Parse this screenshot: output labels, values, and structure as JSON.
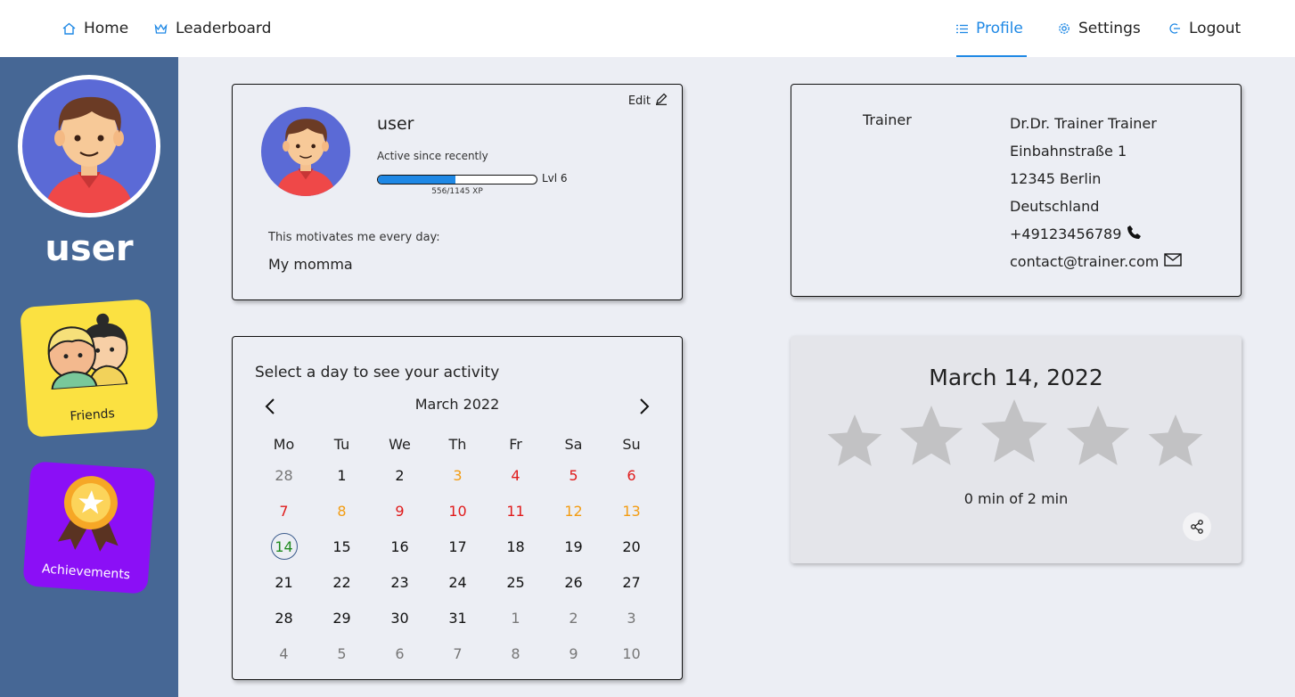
{
  "nav": {
    "home": {
      "label": "Home",
      "icon": "home-icon"
    },
    "leaderboard": {
      "label": "Leaderboard",
      "icon": "crown-icon"
    },
    "profile": {
      "label": "Profile",
      "icon": "list-icon"
    },
    "settings": {
      "label": "Settings",
      "icon": "gear-icon"
    },
    "logout": {
      "label": "Logout",
      "icon": "logout-icon"
    },
    "active_color": "#1e88e5"
  },
  "sidebar": {
    "username": "user",
    "background": "#466795",
    "friends_label": "Friends",
    "achievements_label": "Achievements"
  },
  "profile": {
    "edit_label": "Edit",
    "username": "user",
    "active_since": "Active since recently",
    "level_label": "Lvl 6",
    "xp_text": "556/1145 XP",
    "xp_fraction": 0.486,
    "motto_label": "This motivates me every day:",
    "motto": "My momma"
  },
  "trainer": {
    "role": "Trainer",
    "name": "Dr.Dr. Trainer Trainer",
    "street": "Einbahnstraße 1",
    "city": "12345 Berlin",
    "country": "Deutschland",
    "phone": "+49123456789",
    "email": "contact@trainer.com"
  },
  "calendar": {
    "title": "Select a day to see your activity",
    "month_label": "March 2022",
    "weekdays": [
      "Mo",
      "Tu",
      "We",
      "Th",
      "Fr",
      "Sa",
      "Su"
    ],
    "colors": {
      "gray": "#777777",
      "orange": "#f39c12",
      "red": "#e01b1b",
      "green": "#1f8a1f",
      "normal": "#111111"
    },
    "days": [
      {
        "d": "28",
        "c": "gray"
      },
      {
        "d": "1",
        "c": "normal"
      },
      {
        "d": "2",
        "c": "normal"
      },
      {
        "d": "3",
        "c": "orange"
      },
      {
        "d": "4",
        "c": "red"
      },
      {
        "d": "5",
        "c": "red"
      },
      {
        "d": "6",
        "c": "red"
      },
      {
        "d": "7",
        "c": "red"
      },
      {
        "d": "8",
        "c": "orange"
      },
      {
        "d": "9",
        "c": "red"
      },
      {
        "d": "10",
        "c": "red"
      },
      {
        "d": "11",
        "c": "red"
      },
      {
        "d": "12",
        "c": "orange"
      },
      {
        "d": "13",
        "c": "orange"
      },
      {
        "d": "14",
        "c": "green",
        "selected": true
      },
      {
        "d": "15",
        "c": "normal"
      },
      {
        "d": "16",
        "c": "normal"
      },
      {
        "d": "17",
        "c": "normal"
      },
      {
        "d": "18",
        "c": "normal"
      },
      {
        "d": "19",
        "c": "normal"
      },
      {
        "d": "20",
        "c": "normal"
      },
      {
        "d": "21",
        "c": "normal"
      },
      {
        "d": "22",
        "c": "normal"
      },
      {
        "d": "23",
        "c": "normal"
      },
      {
        "d": "24",
        "c": "normal"
      },
      {
        "d": "25",
        "c": "normal"
      },
      {
        "d": "26",
        "c": "normal"
      },
      {
        "d": "27",
        "c": "normal"
      },
      {
        "d": "28",
        "c": "normal"
      },
      {
        "d": "29",
        "c": "normal"
      },
      {
        "d": "30",
        "c": "normal"
      },
      {
        "d": "31",
        "c": "normal"
      },
      {
        "d": "1",
        "c": "gray"
      },
      {
        "d": "2",
        "c": "gray"
      },
      {
        "d": "3",
        "c": "gray"
      },
      {
        "d": "4",
        "c": "gray"
      },
      {
        "d": "5",
        "c": "gray"
      },
      {
        "d": "6",
        "c": "gray"
      },
      {
        "d": "7",
        "c": "gray"
      },
      {
        "d": "8",
        "c": "gray"
      },
      {
        "d": "9",
        "c": "gray"
      },
      {
        "d": "10",
        "c": "gray"
      }
    ]
  },
  "activity": {
    "date": "March 14, 2022",
    "rating": 0,
    "max_rating": 5,
    "star_color": "#c2c2c4",
    "minutes_text": "0 min of 2 min"
  }
}
